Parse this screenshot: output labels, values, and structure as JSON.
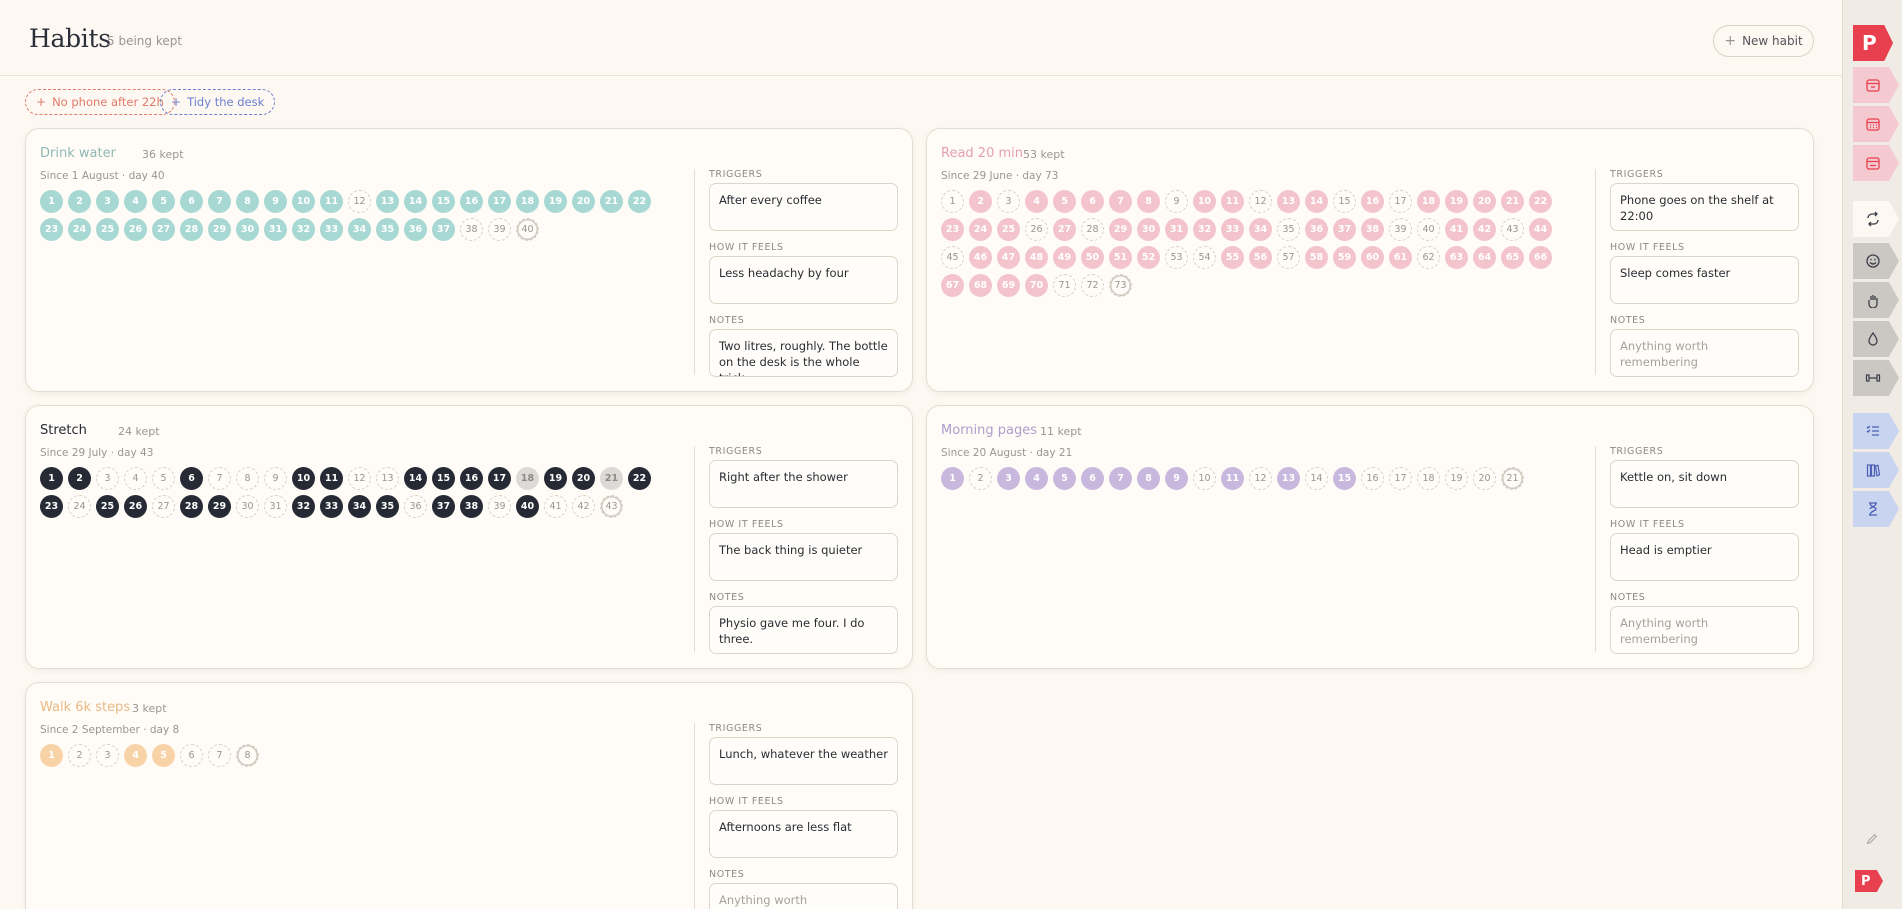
{
  "header": {
    "title": "Habits",
    "count": "5 being kept",
    "new_habit_label": "New habit"
  },
  "chips": [
    {
      "label": "No phone after 22h",
      "color": "#e07a6a"
    },
    {
      "label": "Tidy the desk",
      "color": "#6d7fd0"
    }
  ],
  "field_labels": {
    "triggers": "TRIGGERS",
    "feels": "HOW IT FEELS",
    "notes": "NOTES"
  },
  "cards": [
    {
      "title": "Drink water",
      "kept": "36 kept",
      "since": "Since 1 August · day 40",
      "color": "#a8d8d3",
      "text_color": "#ffffff",
      "title_color": "#8fb8b3",
      "days": 40,
      "off": [
        12,
        38,
        39,
        40
      ],
      "today": 40,
      "triggers": "After every coffee",
      "feels": "Less headachy by four",
      "notes": "Two litres, roughly. The bottle on the desk is the whole trick.",
      "notes_placeholder": false
    },
    {
      "title": "Read 20 min",
      "kept": "53 kept",
      "since": "Since 29 June · day 73",
      "color": "#f3c4cc",
      "text_color": "#ffffff",
      "title_color": "#e4a0ad",
      "days": 73,
      "off": [
        1,
        3,
        9,
        12,
        15,
        17,
        26,
        28,
        35,
        39,
        40,
        43,
        45,
        53,
        54,
        57,
        62,
        71,
        72,
        73
      ],
      "today": 73,
      "triggers": "Phone goes on the shelf at 22:00",
      "feels": "Sleep comes faster",
      "notes": "Anything worth remembering",
      "notes_placeholder": true
    },
    {
      "title": "Stretch",
      "kept": "24 kept",
      "since": "Since 29 July · day 43",
      "color": "#262a35",
      "text_color": "#ffffff",
      "title_color": "#262a35",
      "days": 43,
      "off": [
        3,
        4,
        5,
        7,
        8,
        9,
        12,
        13,
        24,
        27,
        30,
        31,
        36,
        39,
        41,
        42,
        43
      ],
      "today": 43,
      "grey": [
        18,
        21
      ],
      "triggers": "Right after the shower",
      "feels": "The back thing is quieter",
      "notes": "Physio gave me four. I do three.",
      "notes_placeholder": false
    },
    {
      "title": "Morning pages",
      "kept": "11 kept",
      "since": "Since 20 August · day 21",
      "color": "#c9b8dd",
      "text_color": "#ffffff",
      "title_color": "#b09ccb",
      "days": 21,
      "off": [
        2,
        10,
        12,
        14,
        16,
        17,
        18,
        19,
        20,
        21
      ],
      "today": 21,
      "triggers": "Kettle on, sit down",
      "feels": "Head is emptier",
      "notes": "Anything worth remembering",
      "notes_placeholder": true
    },
    {
      "title": "Walk 6k steps",
      "kept": "3 kept",
      "since": "Since 2 September · day 8",
      "color": "#f8d3a8",
      "text_color": "#ffffff",
      "title_color": "#e9b985",
      "days": 8,
      "off": [
        2,
        3,
        6,
        7,
        8
      ],
      "today": 8,
      "triggers": "Lunch, whatever the weather",
      "feels": "Afternoons are less flat",
      "notes": "Anything worth remembering",
      "notes_placeholder": true
    }
  ],
  "rail": {
    "logo_letter": "P",
    "tabs": [
      {
        "name": "calendar-day-icon",
        "bg": "#f4c9cf",
        "stroke": "#e8404e"
      },
      {
        "name": "calendar-month-icon",
        "bg": "#f4c9cf",
        "stroke": "#e8404e"
      },
      {
        "name": "calendar-range-icon",
        "bg": "#f4c9cf",
        "stroke": "#e8404e"
      },
      {
        "name": "repeat-icon",
        "bg": "#fdf8f2",
        "stroke": "#3a3d47"
      },
      {
        "name": "mood-icon",
        "bg": "#cbc8c3",
        "stroke": "#3a3d47"
      },
      {
        "name": "tasks-icon",
        "bg": "#cbc8c3",
        "stroke": "#3a3d47"
      },
      {
        "name": "water-drop-icon",
        "bg": "#cbc8c3",
        "stroke": "#3a3d47"
      },
      {
        "name": "weights-icon",
        "bg": "#cbc8c3",
        "stroke": "#3a3d47"
      },
      {
        "name": "checklist-icon",
        "bg": "#c9d4f0",
        "stroke": "#4c5fb5"
      },
      {
        "name": "books-icon",
        "bg": "#c9d4f0",
        "stroke": "#4c5fb5"
      },
      {
        "name": "hourglass-icon",
        "bg": "#c9d4f0",
        "stroke": "#4c5fb5"
      }
    ]
  }
}
